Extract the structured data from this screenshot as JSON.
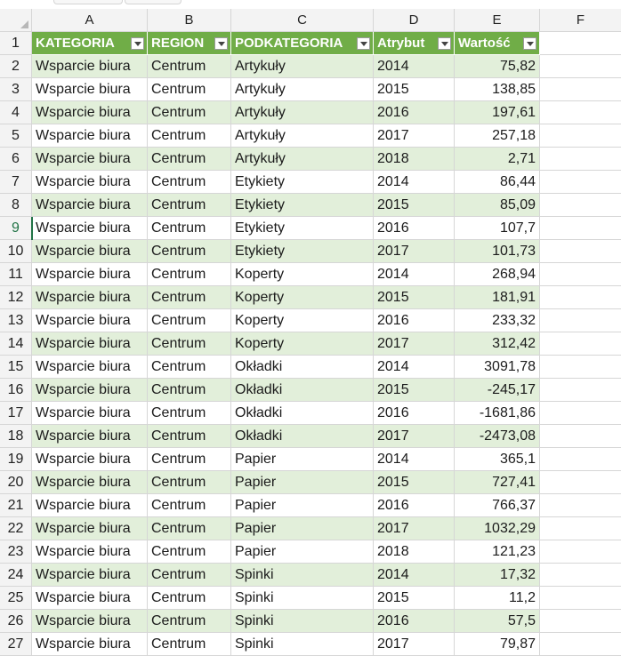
{
  "columns": [
    "A",
    "B",
    "C",
    "D",
    "E",
    "F"
  ],
  "header_row": {
    "row_num": "1",
    "cells": [
      "KATEGORIA",
      "REGION",
      "PODKATEGORIA",
      "Atrybut",
      "Wartość"
    ]
  },
  "rows": [
    {
      "n": "2",
      "kat": "Wsparcie biura",
      "reg": "Centrum",
      "pod": "Artykuły",
      "atr": "2014",
      "war": "75,82"
    },
    {
      "n": "3",
      "kat": "Wsparcie biura",
      "reg": "Centrum",
      "pod": "Artykuły",
      "atr": "2015",
      "war": "138,85"
    },
    {
      "n": "4",
      "kat": "Wsparcie biura",
      "reg": "Centrum",
      "pod": "Artykuły",
      "atr": "2016",
      "war": "197,61"
    },
    {
      "n": "5",
      "kat": "Wsparcie biura",
      "reg": "Centrum",
      "pod": "Artykuły",
      "atr": "2017",
      "war": "257,18"
    },
    {
      "n": "6",
      "kat": "Wsparcie biura",
      "reg": "Centrum",
      "pod": "Artykuły",
      "atr": "2018",
      "war": "2,71"
    },
    {
      "n": "7",
      "kat": "Wsparcie biura",
      "reg": "Centrum",
      "pod": "Etykiety",
      "atr": "2014",
      "war": "86,44"
    },
    {
      "n": "8",
      "kat": "Wsparcie biura",
      "reg": "Centrum",
      "pod": "Etykiety",
      "atr": "2015",
      "war": "85,09"
    },
    {
      "n": "9",
      "kat": "Wsparcie biura",
      "reg": "Centrum",
      "pod": "Etykiety",
      "atr": "2016",
      "war": "107,7"
    },
    {
      "n": "10",
      "kat": "Wsparcie biura",
      "reg": "Centrum",
      "pod": "Etykiety",
      "atr": "2017",
      "war": "101,73"
    },
    {
      "n": "11",
      "kat": "Wsparcie biura",
      "reg": "Centrum",
      "pod": "Koperty",
      "atr": "2014",
      "war": "268,94"
    },
    {
      "n": "12",
      "kat": "Wsparcie biura",
      "reg": "Centrum",
      "pod": "Koperty",
      "atr": "2015",
      "war": "181,91"
    },
    {
      "n": "13",
      "kat": "Wsparcie biura",
      "reg": "Centrum",
      "pod": "Koperty",
      "atr": "2016",
      "war": "233,32"
    },
    {
      "n": "14",
      "kat": "Wsparcie biura",
      "reg": "Centrum",
      "pod": "Koperty",
      "atr": "2017",
      "war": "312,42"
    },
    {
      "n": "15",
      "kat": "Wsparcie biura",
      "reg": "Centrum",
      "pod": "Okładki",
      "atr": "2014",
      "war": "3091,78"
    },
    {
      "n": "16",
      "kat": "Wsparcie biura",
      "reg": "Centrum",
      "pod": "Okładki",
      "atr": "2015",
      "war": "-245,17"
    },
    {
      "n": "17",
      "kat": "Wsparcie biura",
      "reg": "Centrum",
      "pod": "Okładki",
      "atr": "2016",
      "war": "-1681,86"
    },
    {
      "n": "18",
      "kat": "Wsparcie biura",
      "reg": "Centrum",
      "pod": "Okładki",
      "atr": "2017",
      "war": "-2473,08"
    },
    {
      "n": "19",
      "kat": "Wsparcie biura",
      "reg": "Centrum",
      "pod": "Papier",
      "atr": "2014",
      "war": "365,1"
    },
    {
      "n": "20",
      "kat": "Wsparcie biura",
      "reg": "Centrum",
      "pod": "Papier",
      "atr": "2015",
      "war": "727,41"
    },
    {
      "n": "21",
      "kat": "Wsparcie biura",
      "reg": "Centrum",
      "pod": "Papier",
      "atr": "2016",
      "war": "766,37"
    },
    {
      "n": "22",
      "kat": "Wsparcie biura",
      "reg": "Centrum",
      "pod": "Papier",
      "atr": "2017",
      "war": "1032,29"
    },
    {
      "n": "23",
      "kat": "Wsparcie biura",
      "reg": "Centrum",
      "pod": "Papier",
      "atr": "2018",
      "war": "121,23"
    },
    {
      "n": "24",
      "kat": "Wsparcie biura",
      "reg": "Centrum",
      "pod": "Spinki",
      "atr": "2014",
      "war": "17,32"
    },
    {
      "n": "25",
      "kat": "Wsparcie biura",
      "reg": "Centrum",
      "pod": "Spinki",
      "atr": "2015",
      "war": "11,2"
    },
    {
      "n": "26",
      "kat": "Wsparcie biura",
      "reg": "Centrum",
      "pod": "Spinki",
      "atr": "2016",
      "war": "57,5"
    },
    {
      "n": "27",
      "kat": "Wsparcie biura",
      "reg": "Centrum",
      "pod": "Spinki",
      "atr": "2017",
      "war": "79,87"
    }
  ],
  "colors": {
    "header_fill": "#70ad47",
    "band_fill": "#e2efda",
    "grid_line": "#d6d6d6",
    "heading_bg": "#f3f3f3"
  },
  "icons": [
    "filter-dropdown-icon",
    "select-all-corner-icon"
  ]
}
